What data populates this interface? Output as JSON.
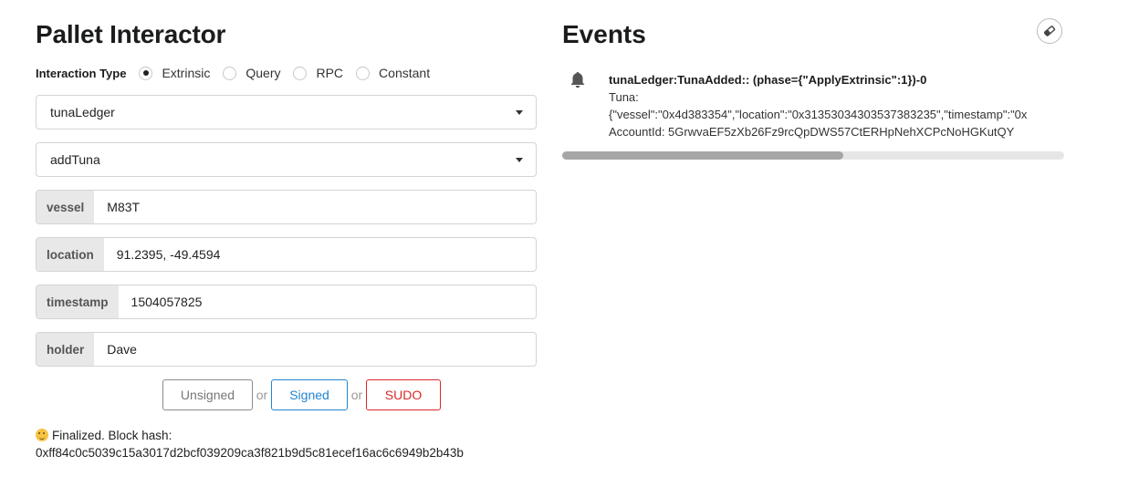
{
  "interactor": {
    "title": "Pallet Interactor",
    "interaction_type_label": "Interaction Type",
    "interaction_types": [
      {
        "label": "Extrinsic",
        "checked": true
      },
      {
        "label": "Query",
        "checked": false
      },
      {
        "label": "RPC",
        "checked": false
      },
      {
        "label": "Constant",
        "checked": false
      }
    ],
    "pallet_value": "tunaLedger",
    "callable_value": "addTuna",
    "params": [
      {
        "label": "vessel",
        "value": "M83T"
      },
      {
        "label": "location",
        "value": "91.2395, -49.4594"
      },
      {
        "label": "timestamp",
        "value": "1504057825"
      },
      {
        "label": "holder",
        "value": "Dave"
      }
    ],
    "buttons": {
      "unsigned": "Unsigned",
      "or1": "or",
      "signed": "Signed",
      "or2": "or",
      "sudo": "SUDO"
    },
    "status_line1": "Finalized. Block hash:",
    "status_line2": "0xff84c0c5039c15a3017d2bcf039209ca3f821b9d5c81ecef16ac6c6949b2b43b",
    "status_emoji": "winking-face-icon"
  },
  "events": {
    "title": "Events",
    "clear_icon": "eraser-icon",
    "items": [
      {
        "icon": "bell-icon",
        "title": "tunaLedger:TunaAdded:: (phase={\"ApplyExtrinsic\":1})-0",
        "line1": "Tuna:",
        "line2": "{\"vessel\":\"0x4d383354\",\"location\":\"0x31353034303537383235\",\"timestamp\":\"0x",
        "line3": "AccountId: 5GrwvaEF5zXb26Fz9rcQpDWS57CtERHpNehXCPcNoHGKutQY"
      }
    ],
    "scroll_position": 0.56
  },
  "colors": {
    "signed": "#2185d0",
    "sudo": "#db2828",
    "unsigned": "#777777"
  }
}
